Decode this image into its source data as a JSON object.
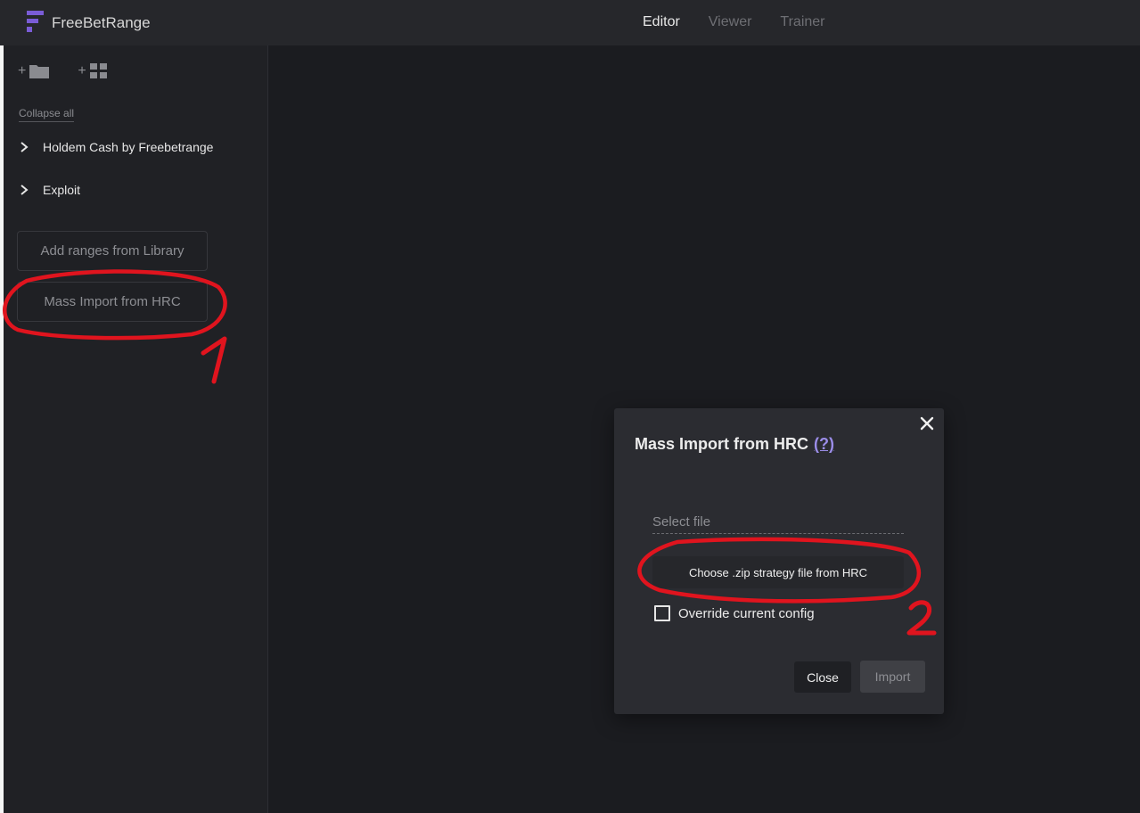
{
  "app": {
    "name": "FreeBetRange",
    "logo_icon": "freebetrange-logo-icon",
    "accent": "#7a5cd6"
  },
  "nav": {
    "tabs": [
      {
        "label": "Editor",
        "active": true
      },
      {
        "label": "Viewer",
        "active": false
      },
      {
        "label": "Trainer",
        "active": false
      }
    ]
  },
  "sidebar": {
    "tools": [
      {
        "prefix": "+",
        "icon": "folder-icon"
      },
      {
        "prefix": "+",
        "icon": "grid-icon"
      }
    ],
    "collapse_all": "Collapse all",
    "tree": [
      {
        "label": "Holdem Cash by Freebetrange",
        "icon": "chevron-right-icon"
      },
      {
        "label": "Exploit",
        "icon": "chevron-right-icon"
      }
    ],
    "buttons": {
      "add_ranges": "Add ranges from Library",
      "mass_import": "Mass Import from HRC"
    }
  },
  "dialog": {
    "title": "Mass Import from HRC",
    "help": "(?)",
    "select_file_placeholder": "Select file",
    "choose_button": "Choose .zip strategy file from HRC",
    "override_label": "Override current config",
    "override_checked": false,
    "close_button": "Close",
    "import_button": "Import",
    "import_disabled": true
  },
  "annotations": {
    "marker_1": "1",
    "marker_2": "2",
    "color": "#e0141e"
  }
}
